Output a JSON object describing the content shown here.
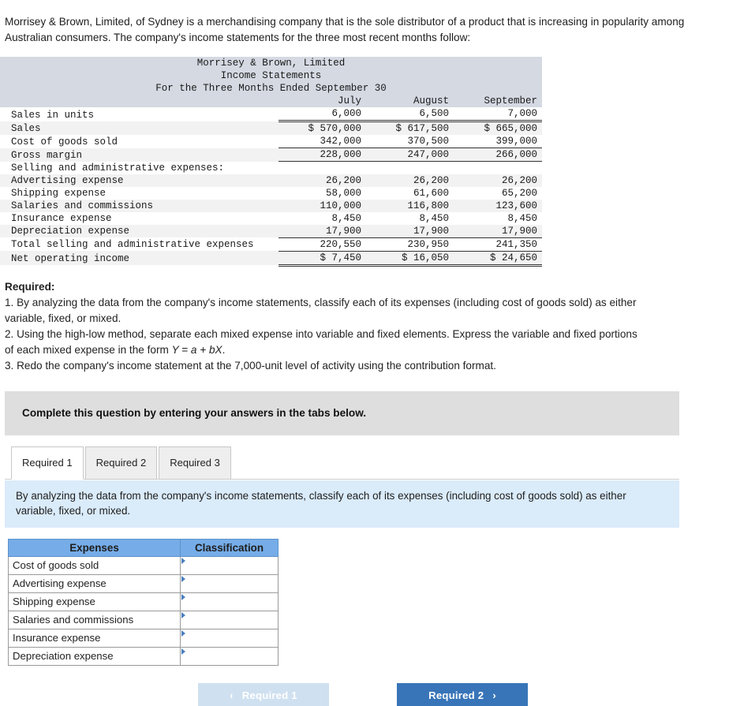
{
  "intro": {
    "paragraph": "Morrisey & Brown, Limited, of Sydney is a merchandising company that is the sole distributor of a product that is increasing in popularity among Australian consumers. The company's income statements for the three most recent months follow:"
  },
  "income_statement": {
    "title_line1": "Morrisey & Brown, Limited",
    "title_line2": "Income Statements",
    "title_line3": "For the Three Months Ended September 30",
    "columns": [
      "July",
      "August",
      "September"
    ],
    "rows": [
      {
        "label": "Sales in units",
        "indent": 0,
        "values": [
          "6,000",
          "6,500",
          "7,000"
        ],
        "shade": false,
        "rule": "double"
      },
      {
        "label": "Sales",
        "indent": 0,
        "values": [
          "$ 570,000",
          "$ 617,500",
          "$ 665,000"
        ],
        "shade": true,
        "rule": "none"
      },
      {
        "label": "Cost of goods sold",
        "indent": 0,
        "values": [
          "342,000",
          "370,500",
          "399,000"
        ],
        "shade": false,
        "rule": "single"
      },
      {
        "label": "Gross margin",
        "indent": 0,
        "values": [
          "228,000",
          "247,000",
          "266,000"
        ],
        "shade": true,
        "rule": "single"
      },
      {
        "label": "Selling and administrative expenses:",
        "indent": 0,
        "values": [
          "",
          "",
          ""
        ],
        "shade": false,
        "rule": "none"
      },
      {
        "label": "Advertising expense",
        "indent": 1,
        "values": [
          "26,200",
          "26,200",
          "26,200"
        ],
        "shade": true,
        "rule": "none"
      },
      {
        "label": "Shipping expense",
        "indent": 1,
        "values": [
          "58,000",
          "61,600",
          "65,200"
        ],
        "shade": false,
        "rule": "none"
      },
      {
        "label": "Salaries and commissions",
        "indent": 1,
        "values": [
          "110,000",
          "116,800",
          "123,600"
        ],
        "shade": true,
        "rule": "none"
      },
      {
        "label": "Insurance expense",
        "indent": 1,
        "values": [
          "8,450",
          "8,450",
          "8,450"
        ],
        "shade": false,
        "rule": "none"
      },
      {
        "label": "Depreciation expense",
        "indent": 1,
        "values": [
          "17,900",
          "17,900",
          "17,900"
        ],
        "shade": true,
        "rule": "single"
      },
      {
        "label": "Total selling and administrative expenses",
        "indent": 0,
        "values": [
          "220,550",
          "230,950",
          "241,350"
        ],
        "shade": false,
        "rule": "single"
      },
      {
        "label": "Net operating income",
        "indent": 0,
        "values": [
          "$ 7,450",
          "$ 16,050",
          "$ 24,650"
        ],
        "shade": true,
        "rule": "double"
      }
    ]
  },
  "required": {
    "heading": "Required:",
    "item1_a": "1. By analyzing the data from the company's income statements, classify each of its expenses (including cost of goods sold) as either",
    "item1_b": "variable, fixed, or mixed.",
    "item2_a": "2. Using the high-low method, separate each mixed expense into variable and fixed elements. Express the variable and fixed portions",
    "item2_b": "of each mixed expense in the form ",
    "item2_formula": "Y = a + bX",
    "item2_c": ".",
    "item3": "3. Redo the company's income statement at the 7,000-unit level of activity using the contribution format."
  },
  "complete_bar": {
    "text": "Complete this question by entering your answers in the tabs below."
  },
  "tabs": [
    {
      "label": "Required 1",
      "active": true
    },
    {
      "label": "Required 2",
      "active": false
    },
    {
      "label": "Required 3",
      "active": false
    }
  ],
  "blue_panel": {
    "text": "By analyzing the data from the company's income statements, classify each of its expenses (including cost of goods sold) as either variable, fixed, or mixed."
  },
  "answer_table": {
    "headers": [
      "Expenses",
      "Classification"
    ],
    "rows": [
      {
        "expense": "Cost of goods sold",
        "classification": ""
      },
      {
        "expense": "Advertising expense",
        "classification": ""
      },
      {
        "expense": "Shipping expense",
        "classification": ""
      },
      {
        "expense": "Salaries and commissions",
        "classification": ""
      },
      {
        "expense": "Insurance expense",
        "classification": ""
      },
      {
        "expense": "Depreciation expense",
        "classification": ""
      }
    ]
  },
  "nav": {
    "prev_label": "Required 1",
    "prev_chevron": "‹",
    "next_label": "Required 2",
    "next_chevron": "›"
  },
  "colors": {
    "statement_header_bg": "#d4d9e2",
    "row_shade": "#f2f2f2",
    "complete_bar_bg": "#dedede",
    "panel_blue": "#daebfa",
    "table_header_blue": "#76ade8",
    "button_active": "#3875b8",
    "button_disabled": "#cfe0f0"
  }
}
